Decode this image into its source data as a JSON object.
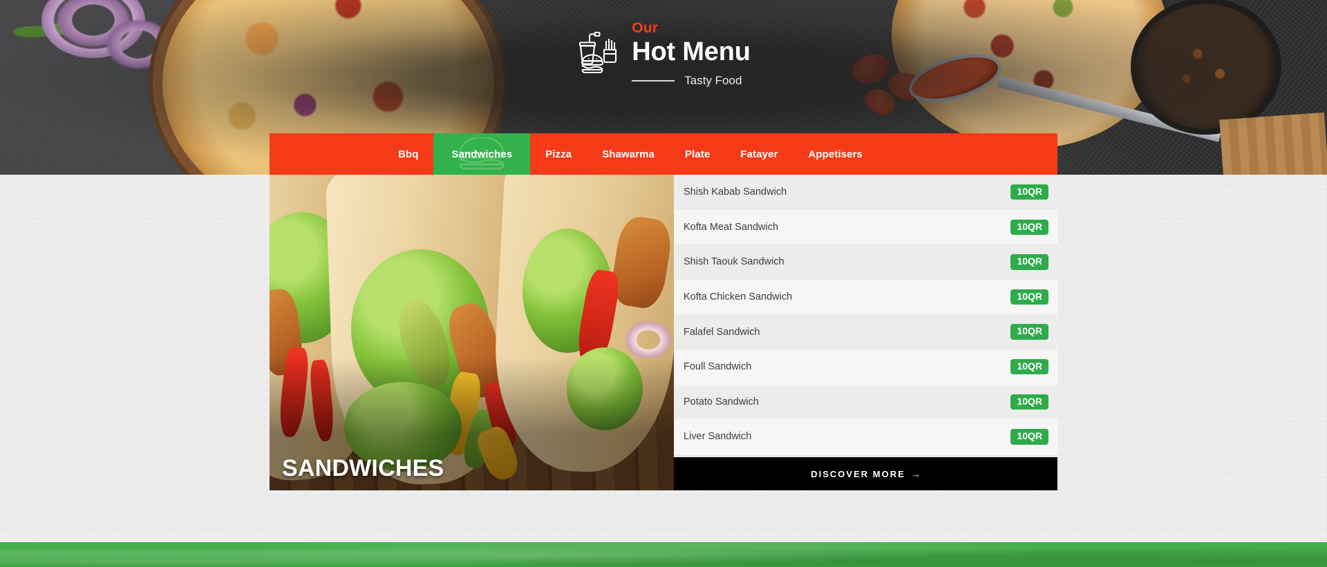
{
  "hero": {
    "logo_icon": "burger-drink-fries-icon",
    "eyebrow": "Our",
    "title": "Hot Menu",
    "subtitle": "Tasty Food"
  },
  "nav": {
    "accent_color": "#F43A17",
    "active_color": "#32B24A",
    "tabs": [
      {
        "label": "Bbq",
        "active": false
      },
      {
        "label": "Sandwiches",
        "active": true
      },
      {
        "label": "Pizza",
        "active": false
      },
      {
        "label": "Shawarma",
        "active": false
      },
      {
        "label": "Plate",
        "active": false
      },
      {
        "label": "Fatayer",
        "active": false
      },
      {
        "label": "Appetisers",
        "active": false
      }
    ]
  },
  "photo": {
    "caption": "SANDWICHES"
  },
  "menu": {
    "items": [
      {
        "name": "Shish Kabab Sandwich",
        "price": "10QR"
      },
      {
        "name": "Kofta Meat Sandwich",
        "price": "10QR"
      },
      {
        "name": "Shish Taouk Sandwich",
        "price": "10QR"
      },
      {
        "name": "Kofta Chicken Sandwich",
        "price": "10QR"
      },
      {
        "name": "Falafel Sandwich",
        "price": "10QR"
      },
      {
        "name": "Foull Sandwich",
        "price": "10QR"
      },
      {
        "name": "Potato Sandwich",
        "price": "10QR"
      },
      {
        "name": "Liver Sandwich",
        "price": "10QR"
      }
    ],
    "price_badge_color": "#2FAB4B"
  },
  "discover": {
    "label": "DISCOVER MORE",
    "arrow": "→"
  },
  "footer": {
    "band_color": "#3BA242"
  }
}
